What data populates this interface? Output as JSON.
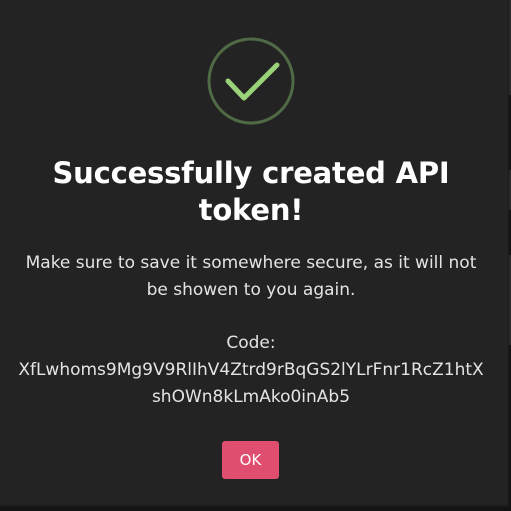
{
  "dialog": {
    "title": "Successfully created API token!",
    "message": "Make sure to save it somewhere secure, as it will not be showen to you again.",
    "code_label": "Code:",
    "code_value": "XfLwhoms9Mg9V9RlIhV4Ztrd9rBqGS2lYLrFnr1RcZ1htXshOWn8kLmAko0inAb5",
    "ok_label": "OK",
    "icon": "checkmark-icon"
  },
  "colors": {
    "modal_background": "#232323",
    "accent_button": "#df4d6f",
    "success_green": "#9ad27a",
    "icon_ring": "#4f6a45"
  }
}
